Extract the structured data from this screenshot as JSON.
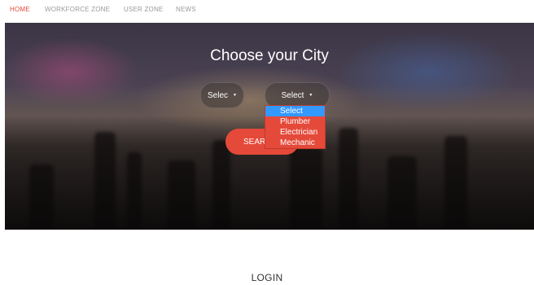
{
  "nav": {
    "items": [
      {
        "label": "HOME",
        "active": true
      },
      {
        "label": "WORKFORCE ZONE",
        "active": false
      },
      {
        "label": "USER ZONE",
        "active": false
      },
      {
        "label": "NEWS",
        "active": false
      }
    ]
  },
  "hero": {
    "title": "Choose your City",
    "city_select": {
      "value": "Selec"
    },
    "service_select": {
      "value": "Select",
      "options": [
        "Select",
        "Plumber",
        "Electrician",
        "Mechanic"
      ],
      "highlighted": "Select"
    },
    "search_button": {
      "label": "SEAR"
    }
  },
  "login": {
    "heading": "LOGIN"
  },
  "colors": {
    "accent": "#e5493a",
    "option_highlight": "#3399ff"
  }
}
